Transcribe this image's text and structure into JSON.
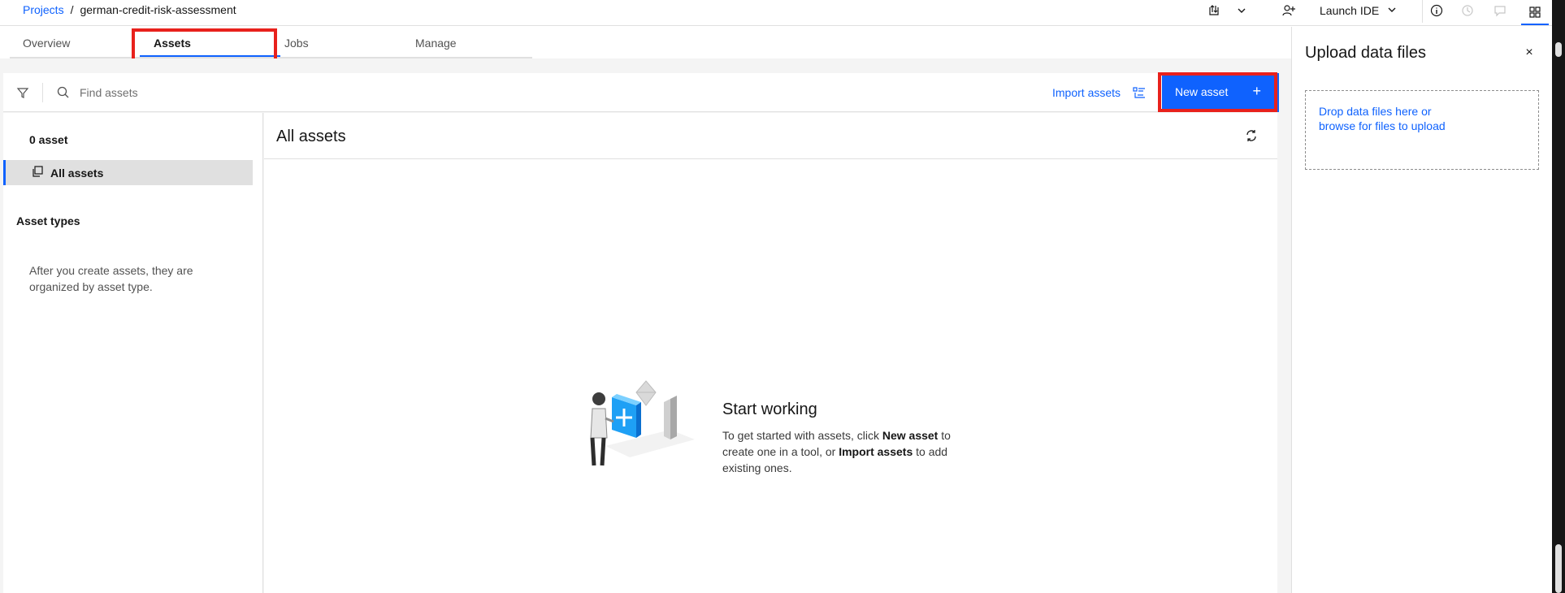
{
  "breadcrumb": {
    "projects": "Projects",
    "separator": "/",
    "current": "german-credit-risk-assessment"
  },
  "header": {
    "launch_ide": "Launch IDE"
  },
  "tabs": [
    {
      "label": "Overview"
    },
    {
      "label": "Assets"
    },
    {
      "label": "Jobs"
    },
    {
      "label": "Manage"
    }
  ],
  "toolbar": {
    "search_placeholder": "Find assets",
    "import_label": "Import assets",
    "new_asset_label": "New asset",
    "new_asset_plus": "+"
  },
  "left": {
    "count": "0 asset",
    "all_assets": "All assets",
    "types_title": "Asset types",
    "types_empty": "After you create assets, they are organized by asset type."
  },
  "main": {
    "title": "All assets",
    "empty_title": "Start working",
    "empty_t1": "To get started with assets, click ",
    "empty_b1": "New asset",
    "empty_t2": " to create one in a tool, or ",
    "empty_b2": "Import assets",
    "empty_t3": " to add existing ones."
  },
  "upload": {
    "title": "Upload data files",
    "close": "×",
    "drop_line1": "Drop data files here or",
    "drop_line2": "browse for files to upload"
  },
  "colors": {
    "accent": "#0f62fe",
    "highlight_box": "#e8211c"
  }
}
